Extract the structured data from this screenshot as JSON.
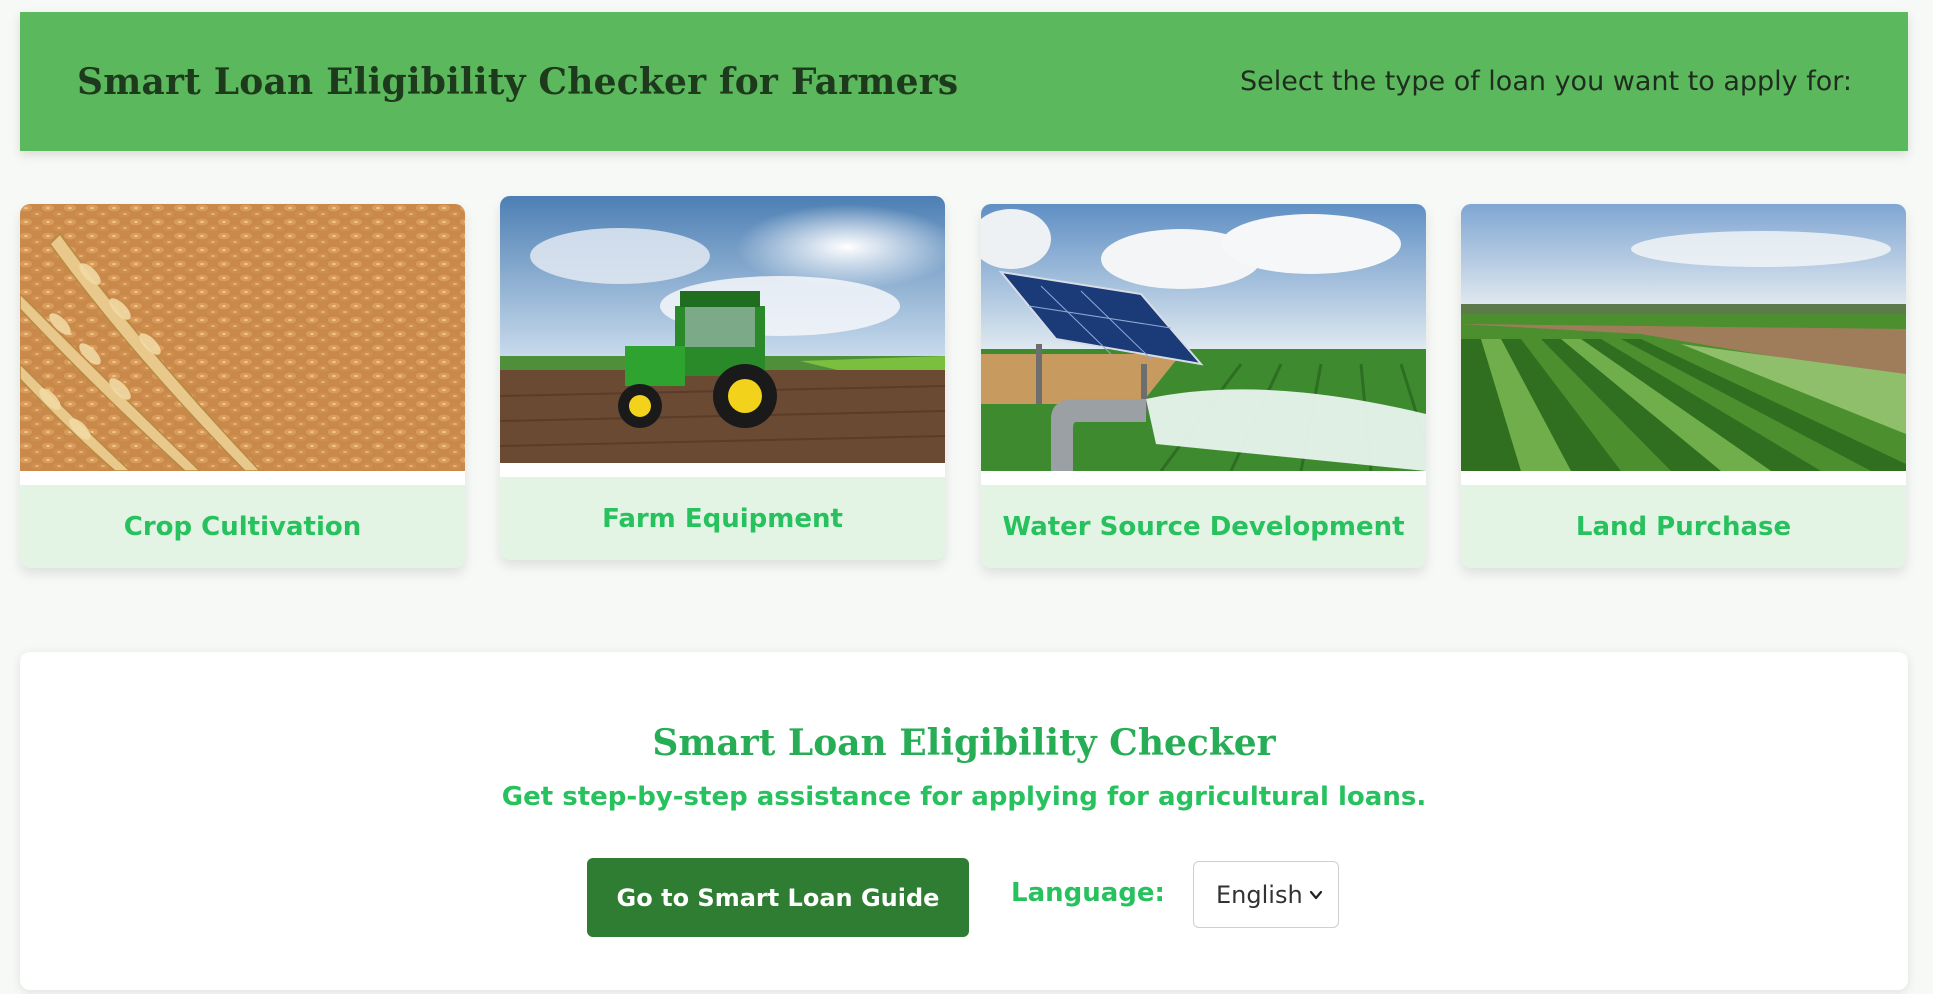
{
  "header": {
    "title": "Smart Loan Eligibility Checker for Farmers",
    "subtitle": "Select the type of loan you want to apply for:"
  },
  "loan_types": [
    {
      "label": "Crop Cultivation",
      "icon": "wheat-grain-image"
    },
    {
      "label": "Farm Equipment",
      "icon": "tractor-image"
    },
    {
      "label": "Water Source Development",
      "icon": "solar-pump-irrigation-image"
    },
    {
      "label": "Land Purchase",
      "icon": "farmland-image"
    }
  ],
  "panel": {
    "title": "Smart Loan Eligibility Checker",
    "subtitle": "Get step-by-step assistance for applying for agricultural loans.",
    "guide_button": "Go to Smart Loan Guide",
    "language_label": "Language:",
    "language_selected": "English"
  },
  "colors": {
    "header_bg": "#5cb85c",
    "card_label": "#27c15e",
    "button_bg": "#2e7d32",
    "card_bg": "#e3f3e4"
  }
}
